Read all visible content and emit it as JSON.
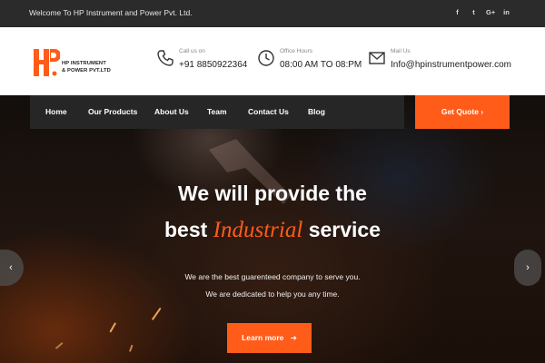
{
  "topbar": {
    "welcome": "Welcome To HP Instrument and Power Pvt. Ltd.",
    "socials": [
      "f",
      "t",
      "G+",
      "in"
    ],
    "social_names": [
      "facebook-icon",
      "twitter-icon",
      "google-plus-icon",
      "linkedin-icon"
    ]
  },
  "header": {
    "logo_text_line1": "HP INSTRUMENT",
    "logo_text_line2": "& POWER PVT.LTD",
    "call": {
      "label": "Call us on",
      "value": "+91 8850922364"
    },
    "hours": {
      "label": "Office Hours",
      "value": "08:00 AM TO 08:PM"
    },
    "mail": {
      "label": "Mail Us",
      "value": "Info@hpinstrumentpower.com"
    }
  },
  "nav": {
    "items": [
      "Home",
      "Our Products",
      "About Us",
      "Team",
      "Contact Us",
      "Blog"
    ],
    "quote_label": "Get Quote"
  },
  "hero": {
    "line1": "We will provide the",
    "line2_pre": "best",
    "line2_accent": "Industrial",
    "line2_post": "service",
    "sub1": "We are the best guarenteed company to serve you.",
    "sub2": "We are dedicated to help you any time.",
    "cta": "Learn more"
  },
  "colors": {
    "accent": "#ff5c1a",
    "topbar": "#2b2b2b",
    "nav": "#262626"
  }
}
